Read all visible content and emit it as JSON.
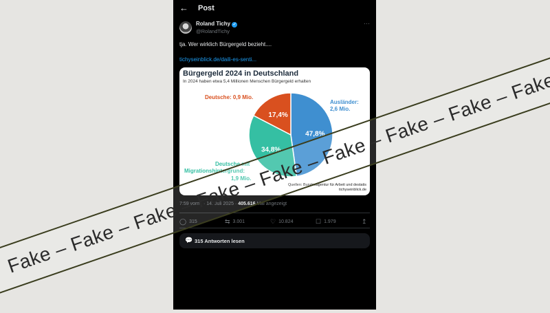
{
  "header": {
    "title": "Post"
  },
  "post": {
    "name": "Roland Tichy",
    "handle": "@RolandTichy",
    "text": "tja. Wer wirklich Bürgergeld bezieht....",
    "link": "tichyseinblick.de/daili-es-senti...",
    "meta": {
      "time": "7:59 vorm. · 14. Juli 2025 · ",
      "views": "405.616",
      "views_label": " Mal angezeigt"
    },
    "actions": {
      "replies": "315",
      "reposts": "3.001",
      "likes": "10.824",
      "bookmarks": "1.979"
    },
    "read_replies": "315 Antworten lesen"
  },
  "infographic": {
    "title": "Bürgergeld 2024 in Deutschland",
    "subtitle": "In 2024 haben etwa 5,4 Millionen Menschen Bürgergeld erhalten",
    "label_deutsche": "Deutsche: 0,9 Mio.",
    "label_auslaender_1": "Ausländer:",
    "label_auslaender_2": "2,6 Mio.",
    "label_migration_1": "Deutsche mit",
    "label_migration_2": "Migrationshintergrund:",
    "label_migration_3": "1,9 Mio.",
    "source_1": "Quellen: Bundesagentur für Arbeit und destatis",
    "source_2": "tichyseinblick.de"
  },
  "chart_data": {
    "type": "pie",
    "title": "Bürgergeld 2024 in Deutschland",
    "categories": [
      "Ausländer",
      "Deutsche mit Migrationshintergrund",
      "Deutsche"
    ],
    "values": [
      47.8,
      34.8,
      17.4
    ],
    "value_labels": [
      "47,8%",
      "34,8%",
      "17,4%"
    ],
    "colors": [
      "#3f8fd0",
      "#35bfa3",
      "#d9501f"
    ]
  },
  "watermark": {
    "text": "Fake – Fake – Fake – Fake – Fake – Fake – Fake – Fake – Fake"
  },
  "colors": {
    "accent": "#1d9bf0",
    "background": "#000000",
    "page_bg": "#e6e5e2"
  }
}
